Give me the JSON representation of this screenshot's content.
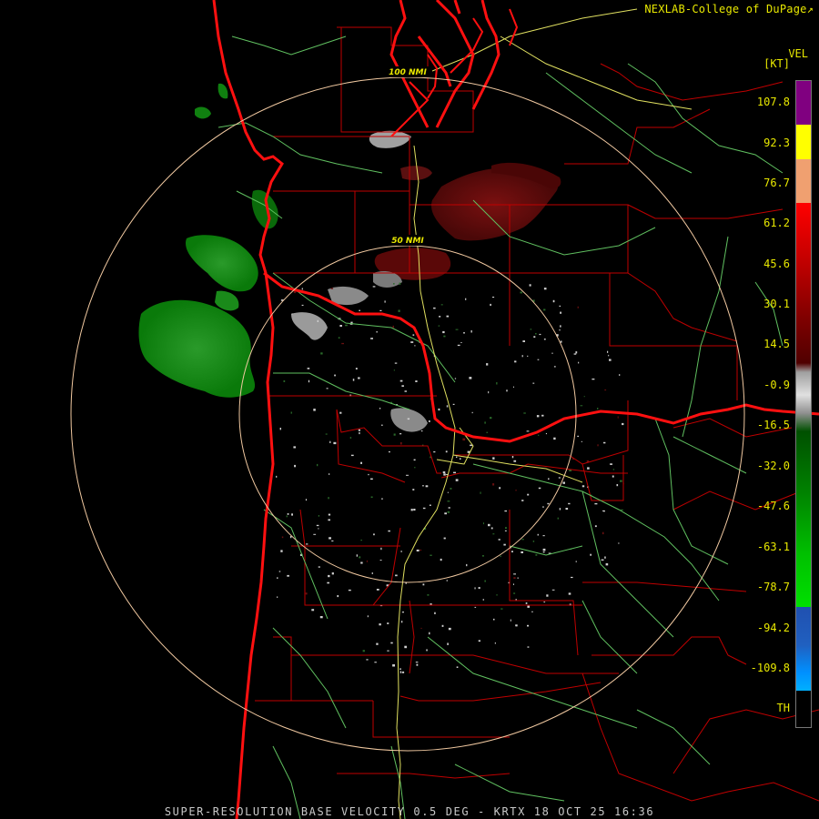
{
  "credit": "NEXLAB-College of DuPage",
  "credit_icon": "external-link-icon",
  "legend": {
    "title": "VEL",
    "unit": "[KT]",
    "ticks": [
      "107.8",
      "92.3",
      "76.7",
      "61.2",
      "45.6",
      "30.1",
      "14.5",
      "-0.9",
      "-16.5",
      "-32.0",
      "-47.6",
      "-63.1",
      "-78.7",
      "-94.2",
      "-109.8",
      "TH"
    ],
    "colors": {
      "purple": "#800080",
      "yellow": "#ffff00",
      "peach": "#f0a070",
      "red": "#ff0000",
      "dark_red": "#600000",
      "gray": "#c0c0c0",
      "dark_green": "#005000",
      "green": "#00e000",
      "blue": "#2060c0",
      "cyan": "#00b0ff"
    }
  },
  "rings": [
    {
      "label": "50 NMI"
    },
    {
      "label": "100 NMI"
    }
  ],
  "colors": {
    "coast": "#ff1010",
    "county": "#c00000",
    "highway": "#e0e060",
    "road": "#60c060",
    "ring": "#f0c8a0",
    "text": "#e8e800"
  },
  "footer": "SUPER-RESOLUTION BASE VELOCITY 0.5 DEG - KRTX 18 OCT 25 16:36"
}
